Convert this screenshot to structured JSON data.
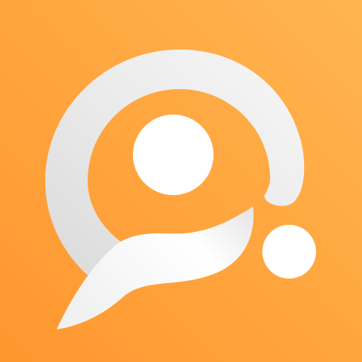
{
  "app_icon": {
    "semantic_name": "chat-bubble-logo-icon",
    "colors": {
      "background_light": "#FFB550",
      "background_dark": "#FF962E",
      "ring_light": "#F2F2F2",
      "ring_shadow": "#D9D9D9",
      "dot_fill": "#FFFFFF",
      "tail_light": "#FFFFFF",
      "tail_shadow": "#E3E3E3"
    }
  }
}
